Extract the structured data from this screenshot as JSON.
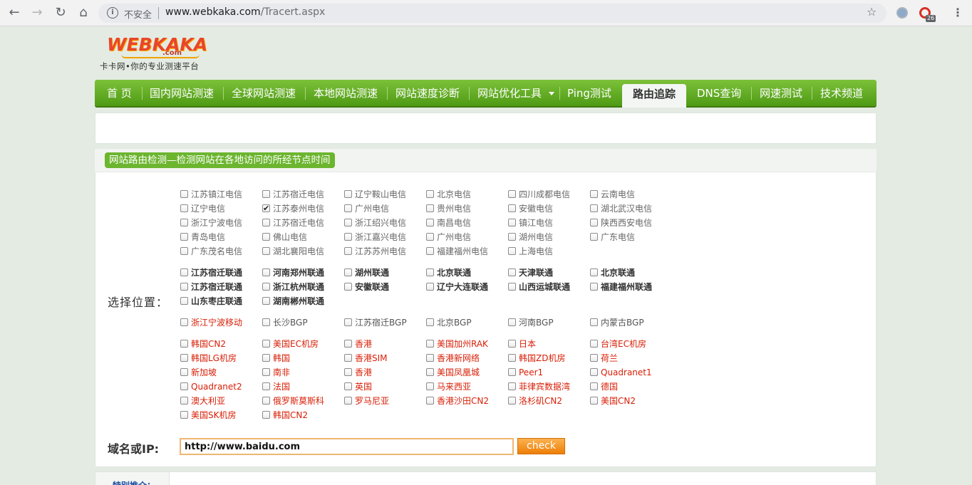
{
  "browser": {
    "insecure_label": "不安全",
    "url_host": "www.webkaka.com",
    "url_path": "/Tracert.aspx",
    "ext_badge": "26"
  },
  "logo": {
    "name": "WEBKAKA",
    "com": ".com",
    "tagline": "卡卡网•你的专业测速平台"
  },
  "nav": {
    "items": [
      "首 页",
      "国内网站测速",
      "全球网站测速",
      "本地网站测速",
      "网站速度诊断",
      "网站优化工具",
      "Ping测试",
      "路由追踪",
      "DNS查询",
      "网速测试",
      "技术频道"
    ],
    "active": "路由追踪"
  },
  "section": {
    "title": "网站路由检测—检测网站在各地访问的所经节点时间",
    "location_label": "选择位置：",
    "ip_label": "域名或IP:",
    "ip_value": "http://www.baidu.com",
    "check_label": "check",
    "bottom_link": "特别推介："
  },
  "telecom": [
    [
      "江苏镇江电信",
      "江苏宿迁电信",
      "辽宁鞍山电信",
      "北京电信",
      "四川成都电信",
      "云南电信"
    ],
    [
      "辽宁电信",
      "江苏泰州电信",
      "广州电信",
      "贵州电信",
      "安徽电信",
      "湖北武汉电信"
    ],
    [
      "浙江宁波电信",
      "江苏宿迁电信",
      "浙江绍兴电信",
      "南昌电信",
      "镇江电信",
      "陕西西安电信"
    ],
    [
      "青岛电信",
      "佛山电信",
      "浙江嘉兴电信",
      "广州电信",
      "湖州电信",
      "广东电信"
    ],
    [
      "广东茂名电信",
      "湖北襄阳电信",
      "江苏苏州电信",
      "福建福州电信",
      "上海电信"
    ]
  ],
  "telecom_checked": "江苏泰州电信",
  "unicom": [
    [
      "江苏宿迁联通",
      "河南郑州联通",
      "湖州联通",
      "北京联通",
      "天津联通",
      "北京联通"
    ],
    [
      "江苏宿迁联通",
      "浙江杭州联通",
      "安徽联通",
      "辽宁大连联通",
      "山西运城联通",
      "福建福州联通"
    ],
    [
      "山东枣庄联通",
      "湖南郴州联通"
    ]
  ],
  "mobile_bgp": [
    "浙江宁波移动",
    "长沙BGP",
    "江苏宿迁BGP",
    "北京BGP",
    "河南BGP",
    "内蒙古BGP"
  ],
  "overseas": [
    [
      "韩国CN2",
      "美国EC机房",
      "香港",
      "美国加州RAK",
      "日本",
      "台湾EC机房"
    ],
    [
      "韩国LG机房",
      "韩国",
      "香港SIM",
      "香港新网络",
      "韩国ZD机房",
      "荷兰"
    ],
    [
      "新加坡",
      "南非",
      "香港",
      "美国凤凰城",
      "Peer1",
      "Quadranet1"
    ],
    [
      "Quadranet2",
      "法国",
      "英国",
      "马来西亚",
      "菲律宾数据湾",
      "德国"
    ],
    [
      "澳大利亚",
      "俄罗斯莫斯科",
      "罗马尼亚",
      "香港沙田CN2",
      "洛杉矶CN2",
      "美国CN2"
    ],
    [
      "美国SK机房",
      "韩国CN2"
    ]
  ]
}
